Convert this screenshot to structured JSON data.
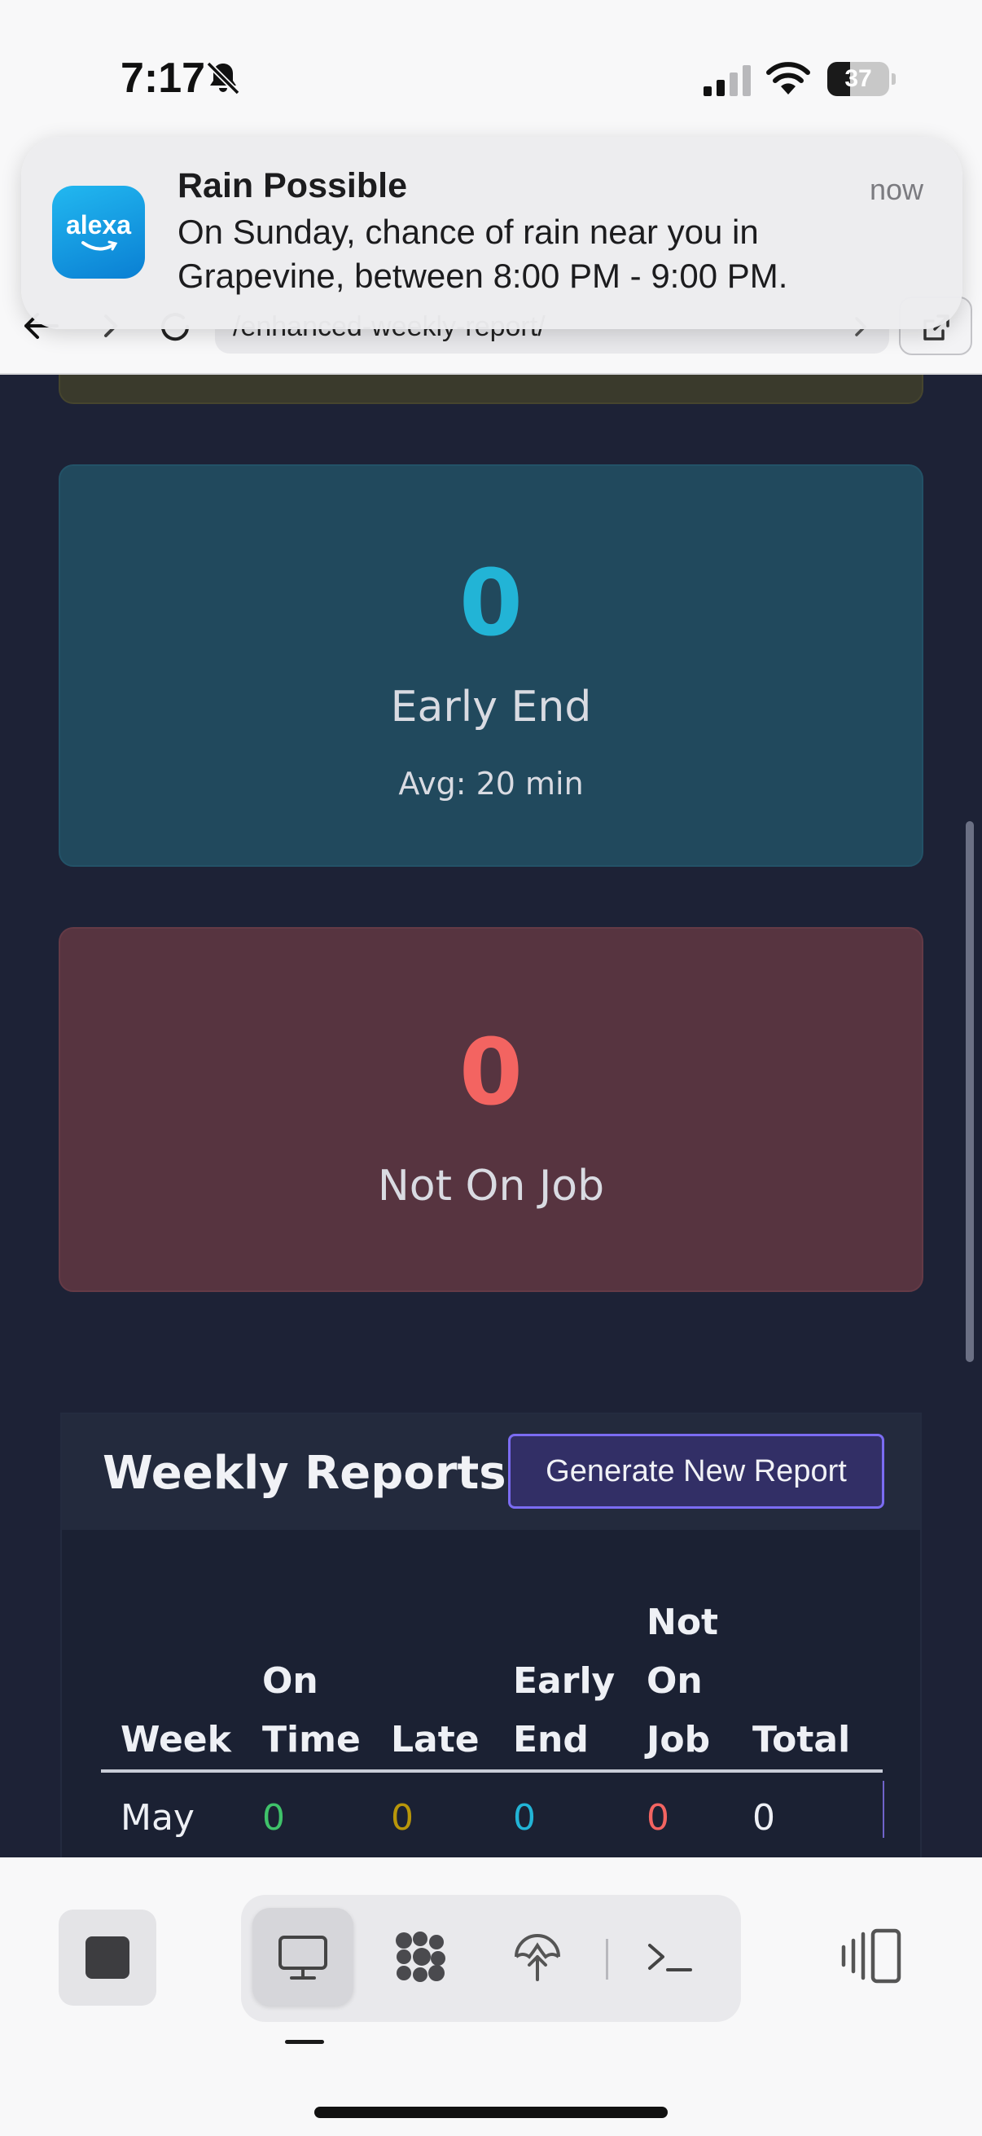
{
  "status_bar": {
    "time": "7:17",
    "battery": "37",
    "battery_level": 0.37,
    "icons": [
      "bell-slash-icon",
      "cellular-signal-icon",
      "wifi-icon",
      "battery-icon"
    ]
  },
  "browser": {
    "url": "/enhanced-weekly-report/",
    "icons": [
      "back-arrow-icon",
      "forward-arrow-icon",
      "reload-icon",
      "chevron-right-icon",
      "share-icon"
    ]
  },
  "notification": {
    "app_icon_text": "alexa",
    "title": "Rain Possible",
    "time": "now",
    "body": "On Sunday, chance of rain near you in Grapevine, between 8:00 PM - 9:00 PM."
  },
  "stats": {
    "early_end": {
      "value": "0",
      "label": "Early End",
      "sub": "Avg: 20 min",
      "color": "#22b4d6"
    },
    "not_on_job": {
      "value": "0",
      "label": "Not On Job",
      "color": "#f36461"
    }
  },
  "reports": {
    "title": "Weekly Reports",
    "generate_label": "Generate New Report",
    "columns": {
      "week": "Week",
      "on_time": "On Time",
      "late": "Late",
      "early_end": "Early End",
      "not_on_job": "Not On Job",
      "total": "Total"
    },
    "rows": [
      {
        "week": "May",
        "on_time": "0",
        "late": "0",
        "early_end": "0",
        "not_on_job": "0",
        "total": "0"
      }
    ],
    "colors": {
      "on_time": "#3fc26a",
      "late": "#b8960a",
      "early_end": "#22b4d6",
      "not_on_job": "#f36461"
    }
  },
  "toolbar": {
    "items": [
      "stop-icon",
      "desktop-icon",
      "apps-icon",
      "tree-icon",
      "terminal-icon",
      "sidebar-toggle-icon"
    ],
    "active": "desktop-icon"
  }
}
